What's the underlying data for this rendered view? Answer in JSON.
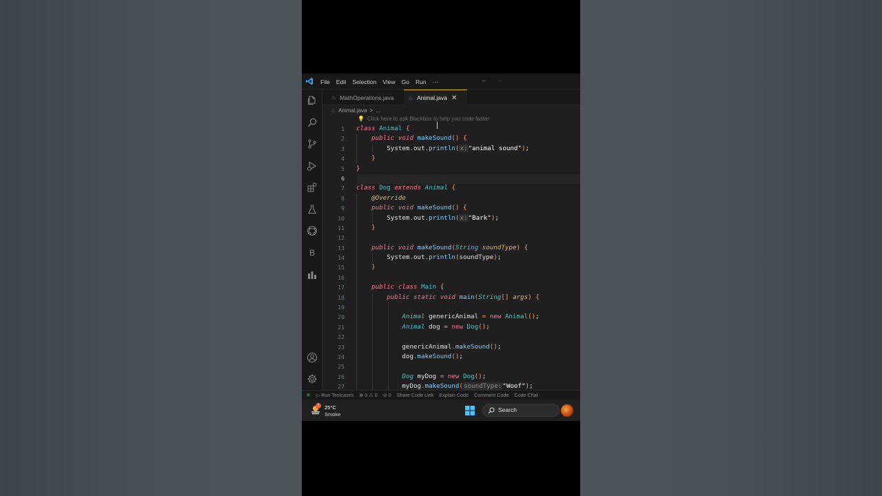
{
  "titlebar": {
    "menu": [
      "File",
      "Edit",
      "Selection",
      "View",
      "Go",
      "Run",
      "···"
    ],
    "back_arrow": "←",
    "forward_arrow": "→"
  },
  "activitybar": {
    "icons": [
      "files-icon",
      "search-icon",
      "source-control-icon",
      "run-debug-icon",
      "extensions-icon",
      "testing-icon",
      "github-icon",
      "blackbox-icon",
      "charts-icon",
      "account-icon",
      "settings-gear-icon"
    ],
    "blackbox_letter": "B"
  },
  "tabs": [
    {
      "label": "MathOperations.java",
      "active": false
    },
    {
      "label": "Animal.java",
      "active": true,
      "close": "✕"
    }
  ],
  "breadcrumb": {
    "file": "Animal.java",
    "separator": ">",
    "rest": "..."
  },
  "hint": {
    "text": "Click here to ask Blackbox to help you code faster"
  },
  "editor": {
    "active_line": 6,
    "line_numbers": [
      "1",
      "2",
      "3",
      "4",
      "5",
      "6",
      "7",
      "8",
      "9",
      "10",
      "11",
      "12",
      "13",
      "14",
      "15",
      "16",
      "17",
      "18",
      "19",
      "20",
      "21",
      "22",
      "23",
      "24",
      "25",
      "26",
      "27"
    ]
  },
  "statusbar": {
    "remote": "✕",
    "run_testcases": "Run Testcases",
    "problems": "⊗ 0 ⚠ 0",
    "ports": "⊘ 0",
    "share": "Share Code Link",
    "explain": "Explain Code",
    "comment": "Comment Code",
    "chat": "Code Chat"
  },
  "taskbar": {
    "weather_temp": "25°C",
    "weather_cond": "Smoke",
    "weather_badge": "1",
    "search_label": "Search"
  },
  "colors": {
    "editor_bg": "#1f1f1f",
    "keyword": "#f7768e",
    "type": "#4fc1c9",
    "active_tab_border": "#d7a800"
  }
}
